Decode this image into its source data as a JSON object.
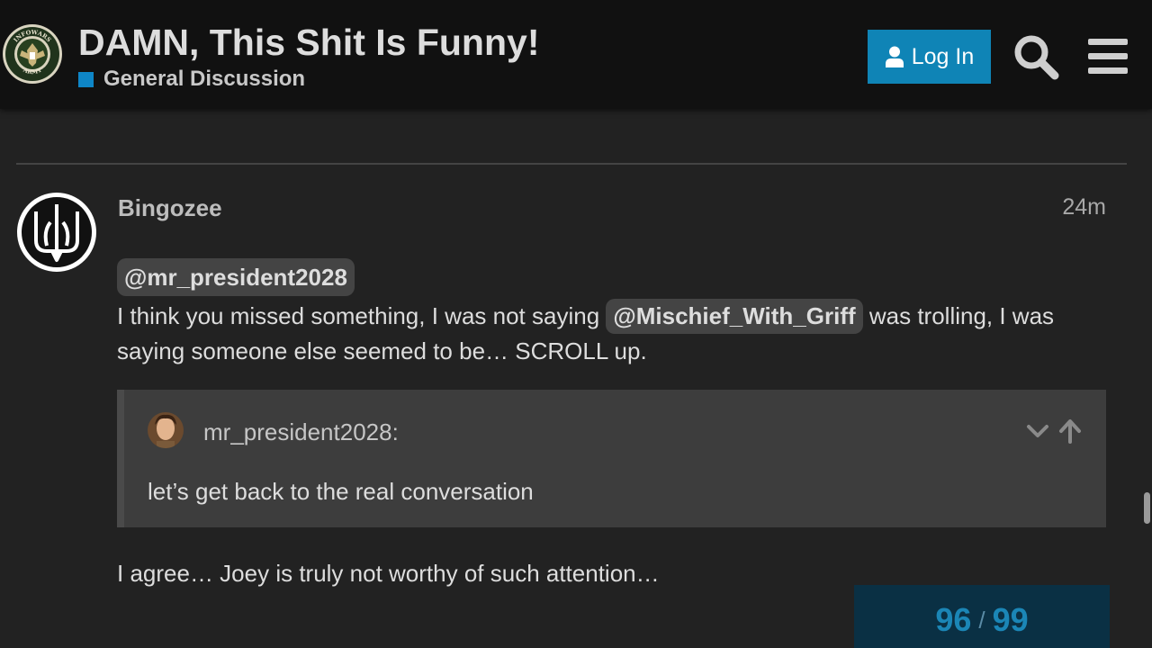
{
  "header": {
    "title": "DAMN, This Shit Is Funny!",
    "category": {
      "name": "General Discussion",
      "color": "#0e86c7"
    },
    "login_label": "Log In",
    "logo_icon": "army-seal-icon",
    "logo_text_top": "INFOWARS",
    "logo_text_bottom": "ARMY",
    "search_icon": "search-icon",
    "menu_icon": "hamburger-menu-icon",
    "accent_color": "#0f84b6"
  },
  "post": {
    "username": "Bingozee",
    "date": "24m",
    "avatar_icon": "trident-icon",
    "reply_mention": "@mr_president2028",
    "text_before_mention": "I think you missed something, I was not saying ",
    "inline_mention": "@Mischief_With_Griff",
    "text_after_mention": " was trolling, I was saying someone else seemed to be… SCROLL up.",
    "quote": {
      "author": "mr_president2028:",
      "text": "let’s get back to the real conversation",
      "expand_icon": "chevron-down-icon",
      "jump_icon": "arrow-up-icon"
    },
    "closing_text": "I agree… Joey is truly not worthy of such attention…"
  },
  "progress": {
    "current": "96",
    "separator": "/",
    "total": "99"
  }
}
